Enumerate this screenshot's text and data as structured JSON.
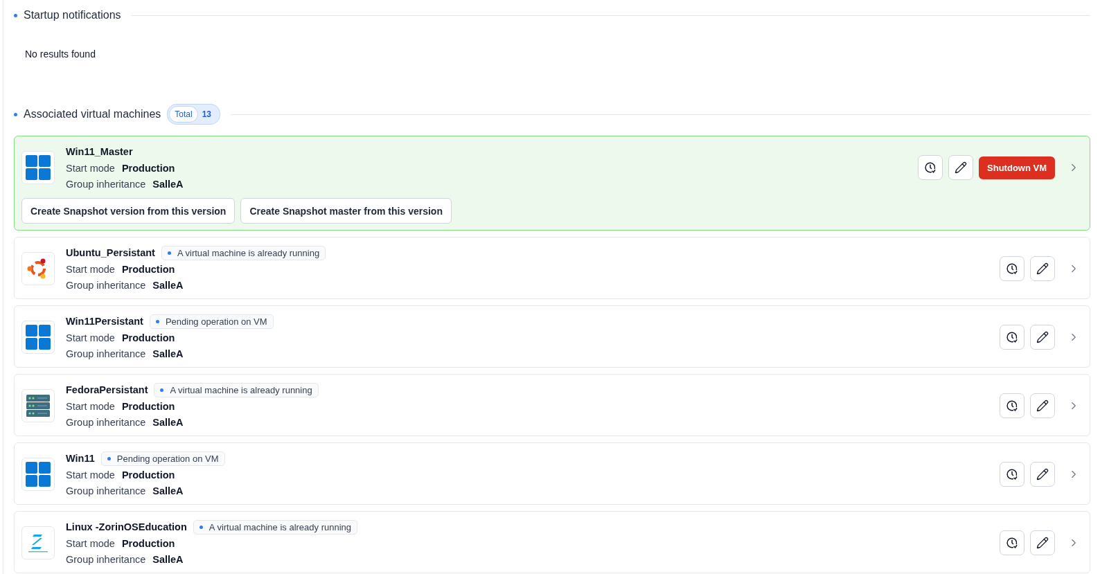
{
  "sections": [
    {
      "title": "Startup notifications",
      "empty_text": "No results found"
    },
    {
      "title": "Associated virtual machines",
      "total_label": "Total",
      "total_count": "13"
    }
  ],
  "vms": [
    {
      "name": "Win11_Master",
      "kind": "windows",
      "running": true,
      "start_mode_label": "Start mode",
      "start_mode": "Production",
      "group_label": "Group inheritance",
      "group": "SalleA",
      "shutdown_label": "Shutdown VM",
      "snapshot_buttons": [
        "Create Snapshot version from this version",
        "Create Snapshot master from this version"
      ]
    },
    {
      "name": "Ubuntu_Persistant",
      "kind": "ubuntu",
      "running": false,
      "status": "A virtual machine is already running",
      "start_mode_label": "Start mode",
      "start_mode": "Production",
      "group_label": "Group inheritance",
      "group": "SalleA"
    },
    {
      "name": "Win11Persistant",
      "kind": "windows",
      "running": false,
      "status": "Pending operation on VM",
      "start_mode_label": "Start mode",
      "start_mode": "Production",
      "group_label": "Group inheritance",
      "group": "SalleA"
    },
    {
      "name": "FedoraPersistant",
      "kind": "server",
      "running": false,
      "status": "A virtual machine is already running",
      "start_mode_label": "Start mode",
      "start_mode": "Production",
      "group_label": "Group inheritance",
      "group": "SalleA"
    },
    {
      "name": "Win11",
      "kind": "windows",
      "running": false,
      "status": "Pending operation on VM",
      "start_mode_label": "Start mode",
      "start_mode": "Production",
      "group_label": "Group inheritance",
      "group": "SalleA"
    },
    {
      "name": "Linux -ZorinOSEducation",
      "kind": "zorin",
      "running": false,
      "status": "A virtual machine is already running",
      "start_mode_label": "Start mode",
      "start_mode": "Production",
      "group_label": "Group inheritance",
      "group": "SalleA"
    }
  ]
}
